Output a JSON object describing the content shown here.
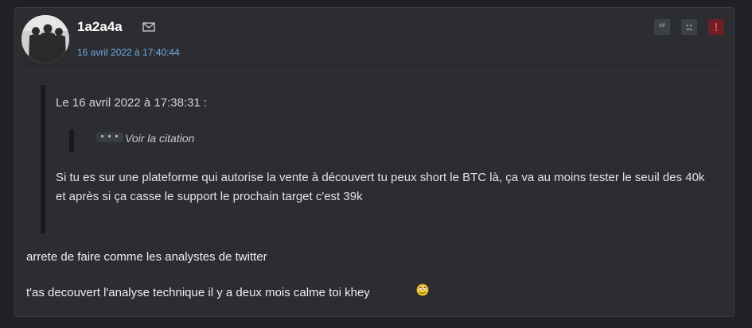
{
  "post": {
    "author": "1a2a4a",
    "date": "16 avril 2022 à 17:40:44",
    "icons": {
      "avatar": "avatar-group-photo",
      "mail": "envelope-icon",
      "quote": "quote-icon",
      "sad": "sad-face-icon",
      "alert": "alert-icon"
    },
    "colors": {
      "link": "#6fa8e0",
      "alert": "#ff3d4a",
      "background": "#2b2d31"
    },
    "quote": {
      "header": "Le 16 avril 2022 à 17:38:31 :",
      "nested_dots": "• • •",
      "nested_link": "Voir la citation",
      "text": "Si tu es sur une plateforme qui autorise la vente à découvert tu peux short le BTC là, ça va au moins tester le seuil des 40k et après si ça casse le support le prochain target c'est 39k"
    },
    "paragraphs": [
      "arrete de faire comme les analystes de twitter",
      "t'as decouvert l'analyse technique il y a deux mois calme toi khey"
    ],
    "emoji": "smiley-rolling-eyes"
  }
}
